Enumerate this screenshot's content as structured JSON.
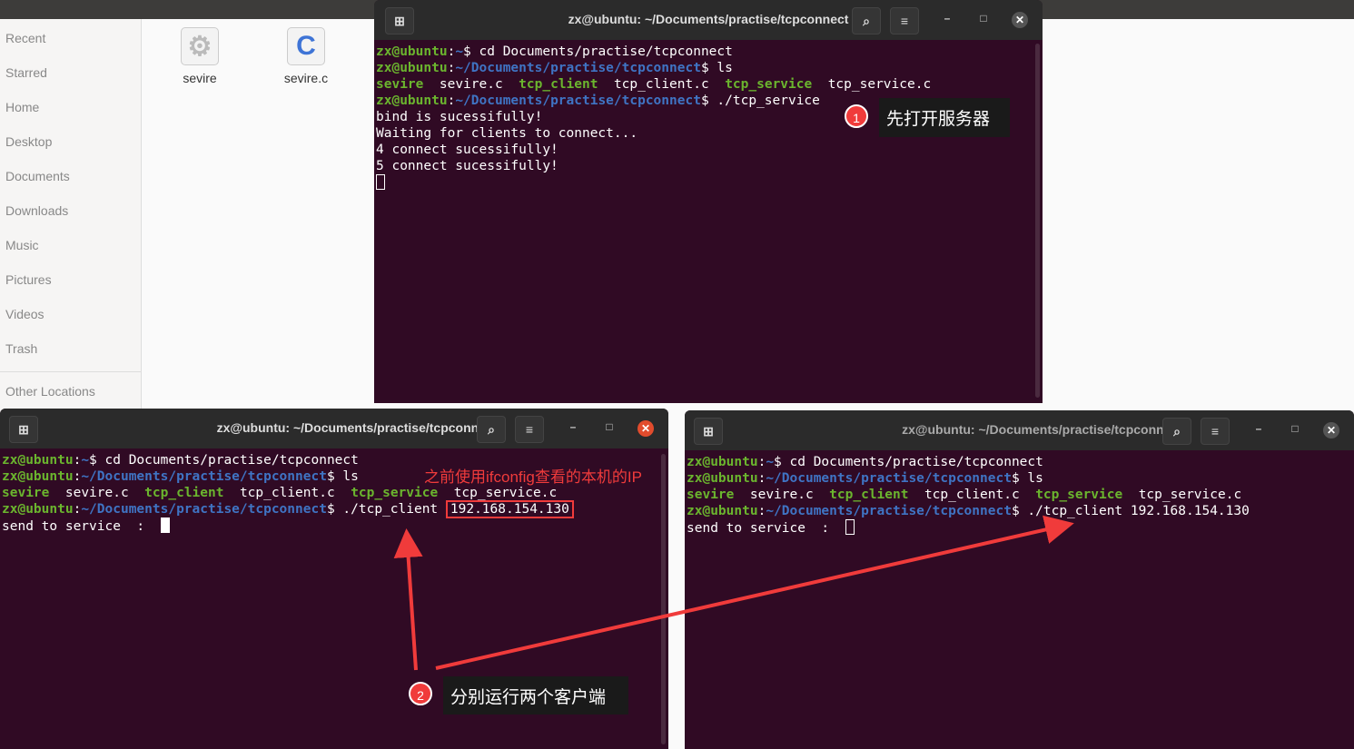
{
  "file_manager": {
    "sidebar": [
      "Recent",
      "Starred",
      "Home",
      "Desktop",
      "Documents",
      "Downloads",
      "Music",
      "Pictures",
      "Videos",
      "Trash"
    ],
    "other_locations": "Other Locations",
    "files": [
      {
        "name": "sevire",
        "icon": "gear-icon"
      },
      {
        "name": "sevire.c",
        "icon": "c-file-icon",
        "glyph": "C"
      }
    ]
  },
  "terminal_title": "zx@ubuntu: ~/Documents/practise/tcpconnect",
  "prompt_user": "zx@ubuntu",
  "colors": {
    "terminal_bg": "#300a24",
    "user_green": "#6bb52e",
    "path_blue": "#3f74c4",
    "annotation_red": "#f03b3b"
  },
  "server": {
    "lines": [
      {
        "path": "~",
        "cmd": " cd Documents/practise/tcpconnect"
      },
      {
        "path": "~/Documents/practise/tcpconnect",
        "cmd": " ls"
      },
      {
        "path": "~/Documents/practise/tcpconnect",
        "cmd": " ./tcp_service"
      }
    ],
    "ls": [
      "sevire",
      "sevire.c",
      "tcp_client",
      "tcp_client.c",
      "tcp_service",
      "tcp_service.c"
    ],
    "output": [
      "bind is sucessifully!",
      "Waiting for clients to connect...",
      "4 connect sucessifully!",
      "5 connect sucessifully!"
    ]
  },
  "client": {
    "cmd": " ./tcp_client ",
    "ip": "192.168.154.130",
    "output": "send to service  :  "
  },
  "annotations": {
    "n1": "1",
    "note1": "先打开服务器",
    "ip_note": "之前使用ifconfig查看的本机的IP",
    "n2": "2",
    "note2": "分别运行两个客户端"
  }
}
